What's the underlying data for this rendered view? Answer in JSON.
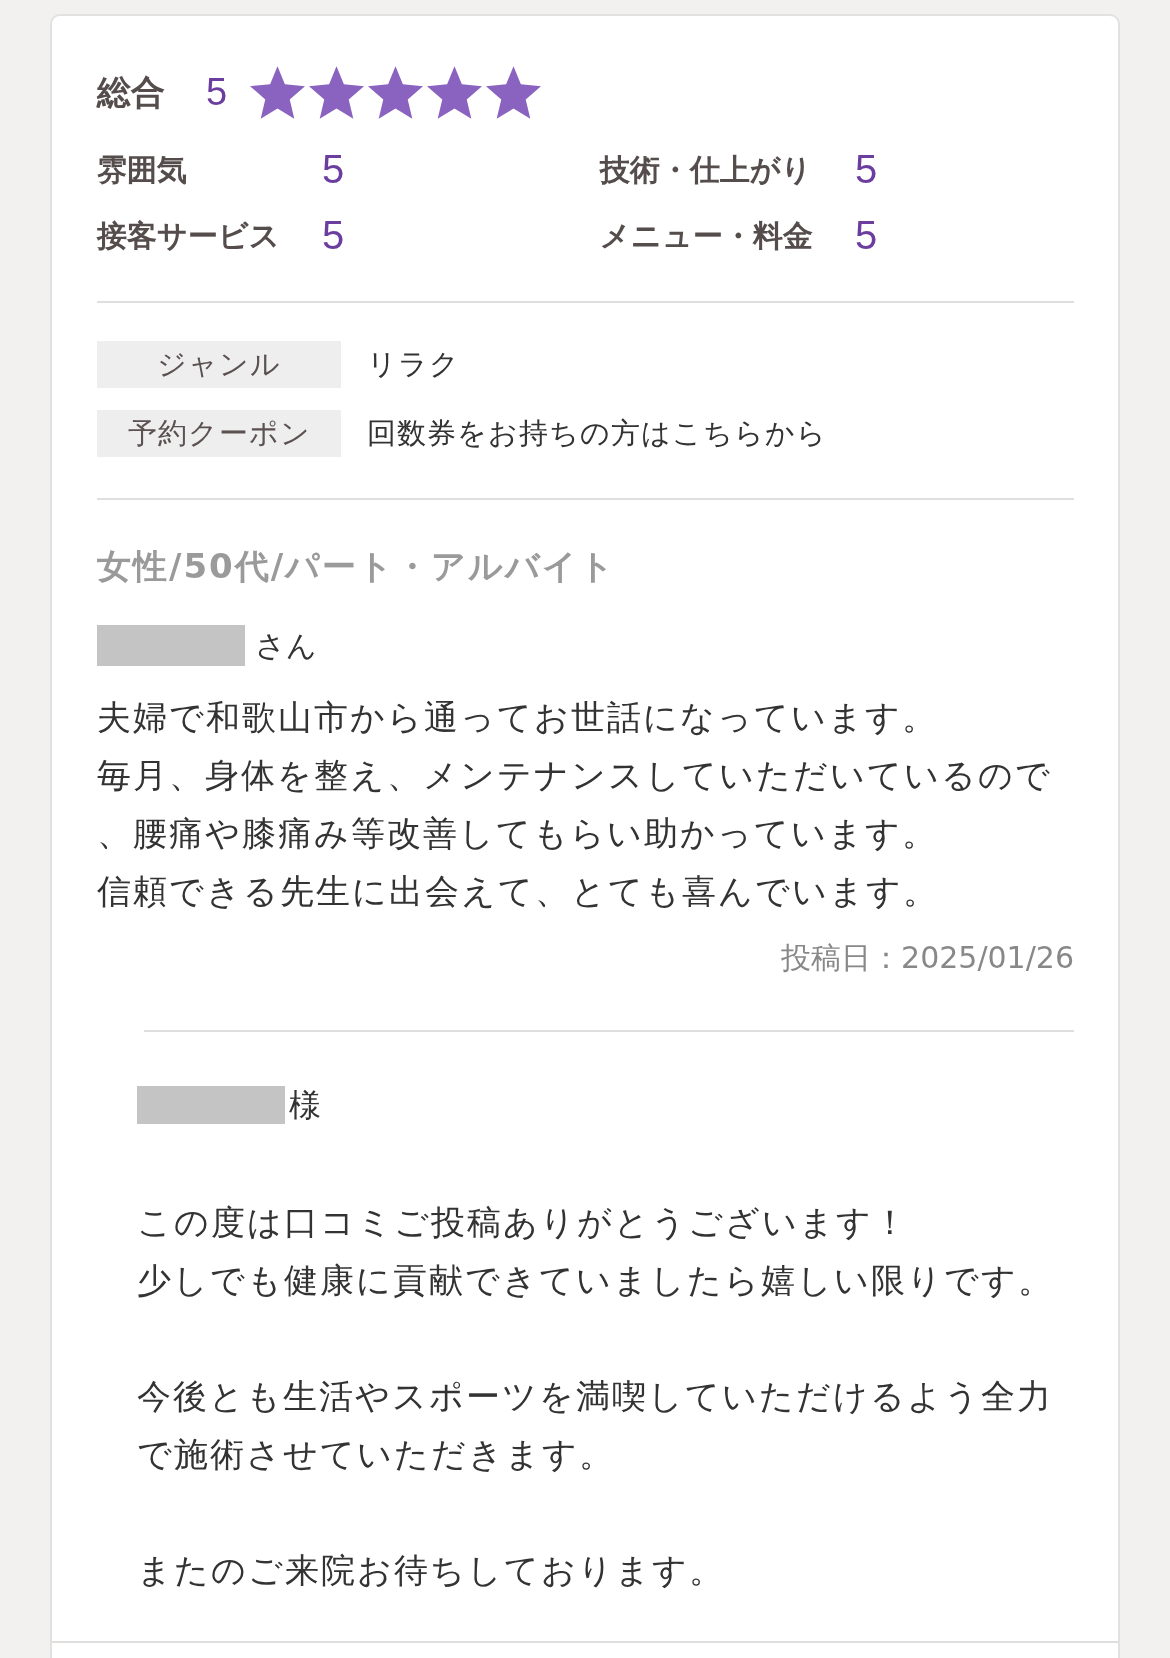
{
  "overall": {
    "label": "総合",
    "score": "5",
    "stars": 5
  },
  "ratings": [
    {
      "label": "雰囲気",
      "score": "5"
    },
    {
      "label": "技術・仕上がり",
      "score": "5"
    },
    {
      "label": "接客サービス",
      "score": "5"
    },
    {
      "label": "メニュー・料金",
      "score": "5"
    }
  ],
  "details": [
    {
      "label": "ジャンル",
      "value": "リラク"
    },
    {
      "label": "予約クーポン",
      "value": "回数券をお持ちの方はこちらから"
    }
  ],
  "review": {
    "reviewer": "女性/50代/パート・アルバイト",
    "name_suffix": "さん",
    "lines": [
      "夫婦で和歌山市から通ってお世話になっています。",
      "毎月、身体を整え、メンテナンスしていただいているので",
      "、腰痛や膝痛み等改善してもらい助かっています。",
      "信頼できる先生に出会えて、とても喜んでいます。"
    ],
    "posted": "投稿日：2025/01/26"
  },
  "reply": {
    "name_suffix": "様",
    "paragraphs": [
      [
        "この度は口コミご投稿ありがとうございます！",
        "少しでも健康に貢献できていましたら嬉しい限りです。"
      ],
      [
        "今後とも生活やスポーツを満喫していただけるよう全力",
        "で施術させていただきます。"
      ],
      [
        "またのご来院お待ちしております。"
      ]
    ]
  }
}
